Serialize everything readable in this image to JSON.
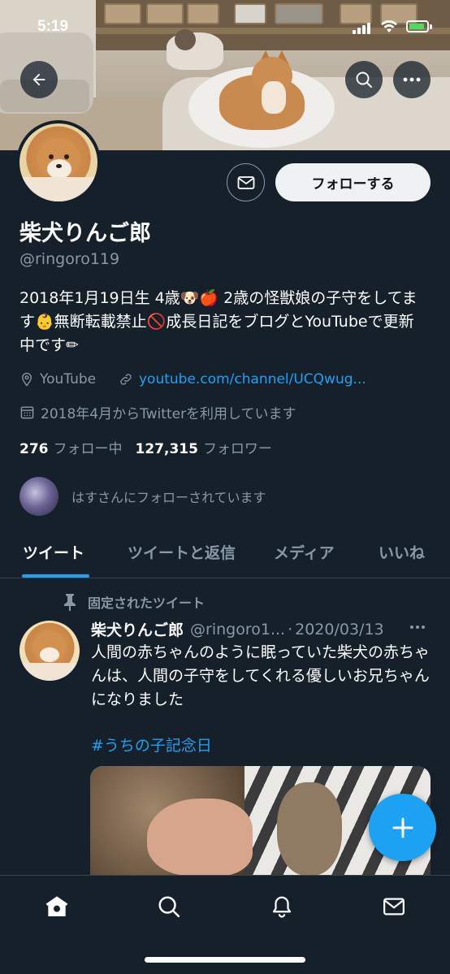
{
  "status_bar": {
    "time": "5:19"
  },
  "profile": {
    "name": "柴犬りんご郎",
    "handle": "@ringoro119",
    "follow_label": "フォローする",
    "bio": "2018年1月19日生 4歳🐶🍎 2歳の怪獣娘の子守をしてます👶無断転載禁止🚫成長日記をブログとYouTubeで更新中です✏",
    "location": "YouTube",
    "link": "youtube.com/channel/UCQwug...",
    "joined": "2018年4月からTwitterを利用しています",
    "following_count": "276",
    "following_label": "フォロー中",
    "followers_count": "127,315",
    "followers_label": "フォロワー",
    "followed_by": "はすさんにフォローされています"
  },
  "tabs": [
    {
      "label": "ツイート",
      "active": true
    },
    {
      "label": "ツイートと返信",
      "active": false
    },
    {
      "label": "メディア",
      "active": false
    },
    {
      "label": "いいね",
      "active": false
    }
  ],
  "pinned_tweet": {
    "pinned_label": "固定されたツイート",
    "author_name": "柴犬りんご郎",
    "author_handle": "@ringoro1...",
    "separator": "·",
    "date": "2020/03/13",
    "text": "人間の赤ちゃんのように眠っていた柴犬の赤ちゃんは、人間の子守をしてくれる優しいお兄ちゃんになりました",
    "hashtag": "#うちの子記念日"
  },
  "bottom_nav": [
    "home-icon",
    "search-icon",
    "notifications-icon",
    "messages-icon"
  ],
  "colors": {
    "background": "#15202b",
    "accent": "#1da1f2",
    "secondary_text": "#8899a6",
    "divider": "#38444d"
  }
}
